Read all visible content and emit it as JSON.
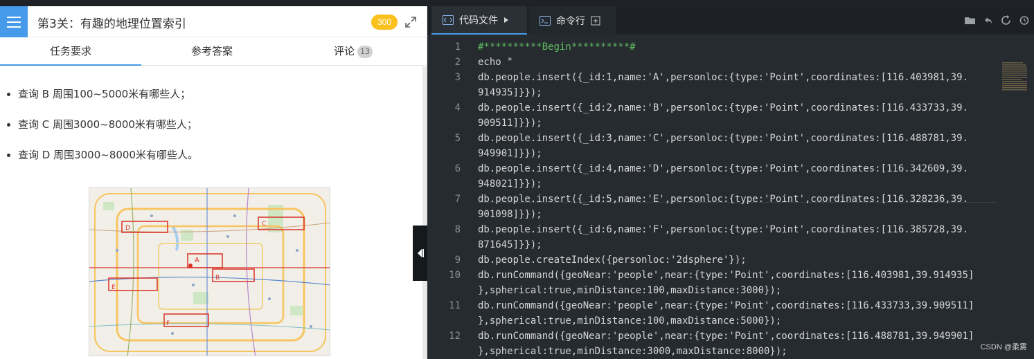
{
  "header": {
    "title": "第3关：有趣的地理位置索引",
    "score": "300"
  },
  "tabs": [
    {
      "label": "任务要求"
    },
    {
      "label": "参考答案"
    },
    {
      "label": "评论",
      "count": "13"
    }
  ],
  "tasks": [
    "查询 B 周围100~5000米有哪些人；",
    "查询 C 周围3000~8000米有哪些人；",
    "查询 D 周围3000~8000米有哪些人。"
  ],
  "map": {
    "labels": [
      "A",
      "B",
      "C",
      "D",
      "E",
      "F"
    ]
  },
  "editor": {
    "tab_code": "代码文件",
    "tab_cmd": "命令行",
    "lines": [
      {
        "n": "1",
        "text": "#**********Begin**********#",
        "comment": true
      },
      {
        "n": "2",
        "text": "echo \""
      },
      {
        "n": "3",
        "text": "db.people.insert({_id:1,name:'A',personloc:{type:'Point',coordinates:[116.403981,39."
      },
      {
        "n": "",
        "text": "914935]}});"
      },
      {
        "n": "4",
        "text": "db.people.insert({_id:2,name:'B',personloc:{type:'Point',coordinates:[116.433733,39."
      },
      {
        "n": "",
        "text": "909511]}});"
      },
      {
        "n": "5",
        "text": "db.people.insert({_id:3,name:'C',personloc:{type:'Point',coordinates:[116.488781,39."
      },
      {
        "n": "",
        "text": "949901]}});"
      },
      {
        "n": "6",
        "text": "db.people.insert({_id:4,name:'D',personloc:{type:'Point',coordinates:[116.342609,39."
      },
      {
        "n": "",
        "text": "948021]}});"
      },
      {
        "n": "7",
        "text": "db.people.insert({_id:5,name:'E',personloc:{type:'Point',coordinates:[116.328236,39."
      },
      {
        "n": "",
        "text": "901098]}});"
      },
      {
        "n": "8",
        "text": "db.people.insert({_id:6,name:'F',personloc:{type:'Point',coordinates:[116.385728,39."
      },
      {
        "n": "",
        "text": "871645]}});"
      },
      {
        "n": "9",
        "text": "db.people.createIndex({personloc:'2dsphere'});"
      },
      {
        "n": "10",
        "text": "db.runCommand({geoNear:'people',near:{type:'Point',coordinates:[116.403981,39.914935]"
      },
      {
        "n": "",
        "text": "},spherical:true,minDistance:100,maxDistance:3000});"
      },
      {
        "n": "11",
        "text": "db.runCommand({geoNear:'people',near:{type:'Point',coordinates:[116.433733,39.909511]"
      },
      {
        "n": "",
        "text": "},spherical:true,minDistance:100,maxDistance:5000});"
      },
      {
        "n": "12",
        "text": "db.runCommand({geoNear:'people',near:{type:'Point',coordinates:[116.488781,39.949901]"
      },
      {
        "n": "",
        "text": "},spherical:true,minDistance:3000,maxDistance:8000});"
      }
    ]
  },
  "watermark": "CSDN @柔雾"
}
